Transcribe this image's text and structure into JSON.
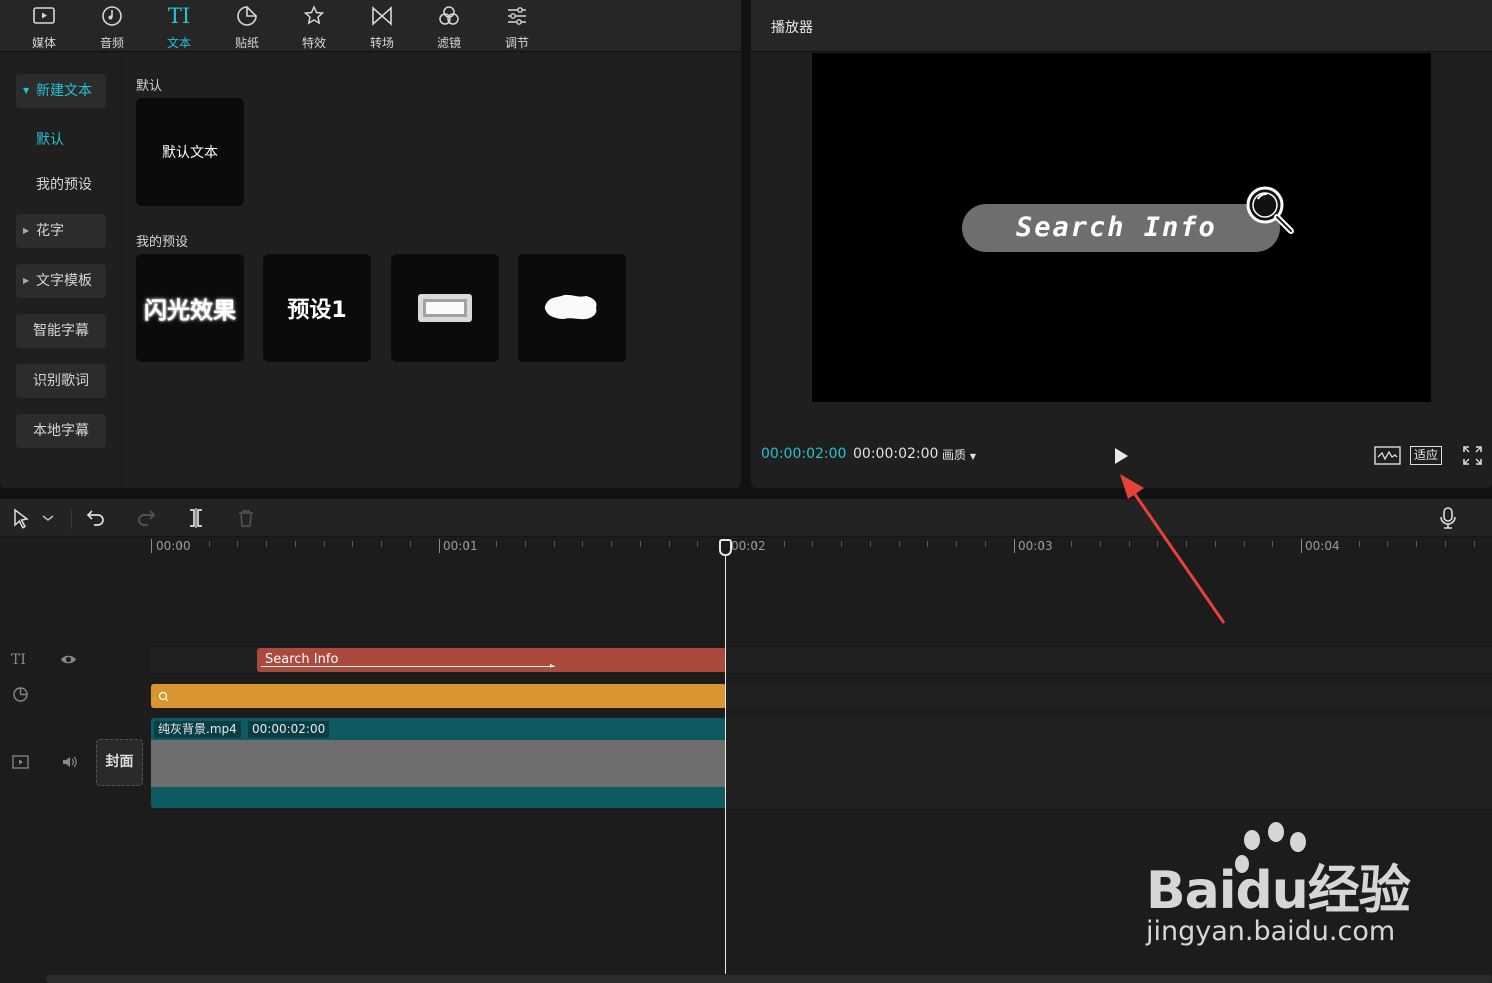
{
  "toolbar": {
    "tabs": [
      {
        "label": "媒体",
        "icon": "media-icon"
      },
      {
        "label": "音频",
        "icon": "audio-icon"
      },
      {
        "label": "文本",
        "icon": "text-icon",
        "active": true
      },
      {
        "label": "贴纸",
        "icon": "sticker-icon"
      },
      {
        "label": "特效",
        "icon": "effects-icon"
      },
      {
        "label": "转场",
        "icon": "transition-icon"
      },
      {
        "label": "滤镜",
        "icon": "filter-icon"
      },
      {
        "label": "调节",
        "icon": "adjust-icon"
      }
    ],
    "text_tab_glyph": "TI"
  },
  "sidebar": {
    "new_text": "新建文本",
    "default": "默认",
    "my_presets": "我的预设",
    "fancy": "花字",
    "templates": "文字模板",
    "smart_caption": "智能字幕",
    "lyrics": "识别歌词",
    "local_caption": "本地字幕"
  },
  "content": {
    "default_section": "默认",
    "default_card": "默认文本",
    "presets_section": "我的预设",
    "preset_cards": [
      "闪光效果",
      "预设1",
      "",
      ""
    ]
  },
  "player": {
    "title": "播放器",
    "preview_text": "Search Info",
    "current_time": "00:00:02:00",
    "total_time": "00:00:02:00",
    "quality_label": "画质",
    "fit_label": "适应"
  },
  "timeline": {
    "ruler_labels": [
      "00:00",
      "00:01",
      "00:02",
      "00:03",
      "00:04"
    ],
    "text_track_glyph": "TI",
    "text_clip_label": "Search Info",
    "video_clip_name": "纯灰背景.mp4",
    "video_clip_duration": "00:00:02:00",
    "cover_label": "封面"
  },
  "watermark": {
    "logo": "Baidu经验",
    "url": "jingyan.baidu.com"
  },
  "colors": {
    "accent": "#27c3cf",
    "text_clip": "#a94a3c",
    "effect_clip": "#d89530",
    "video_clip": "#0d5a60",
    "annotation_arrow": "#e8413a"
  }
}
